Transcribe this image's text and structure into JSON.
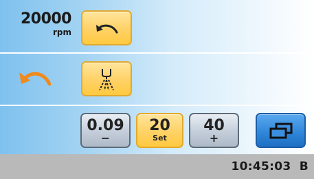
{
  "speed": {
    "value": "20000",
    "unit": "rpm"
  },
  "controls": {
    "direction_icon": "rotate-counterclockwise-icon",
    "spray_icon": "water-spray-icon",
    "status_rotation_icon": "rotation-direction-icon",
    "window_icon": "windows-overlap-icon"
  },
  "presets": {
    "low": {
      "value": "0.09",
      "sub": "−"
    },
    "set": {
      "value": "20",
      "sub": "Set"
    },
    "high": {
      "value": "40",
      "sub": "+"
    }
  },
  "status": {
    "time": "10:45:03",
    "mode": "B"
  },
  "colors": {
    "accent_orange": "#f08a1c",
    "button_yellow": "#ffd36b",
    "button_blue": "#2e84d8"
  }
}
